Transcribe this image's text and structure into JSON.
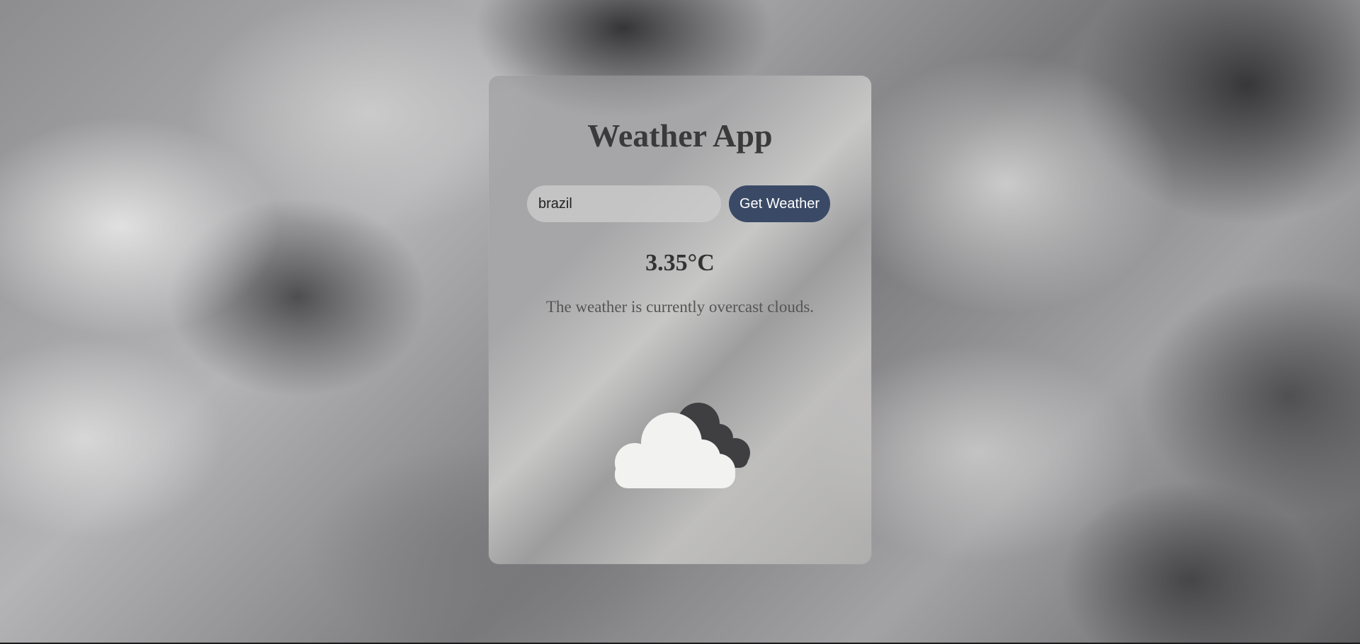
{
  "app": {
    "title": "Weather App"
  },
  "search": {
    "value": "brazil",
    "placeholder": "",
    "button_label": "Get Weather"
  },
  "weather": {
    "temperature": "3.35°C",
    "description": "The weather is currently overcast clouds.",
    "icon": "overcast-clouds-icon"
  },
  "colors": {
    "button_background": "#3a4a66",
    "button_text": "#ffffff",
    "title_text": "#3a3a3a",
    "dark_cloud": "#3f3f42",
    "light_cloud": "#f2f2f0"
  }
}
